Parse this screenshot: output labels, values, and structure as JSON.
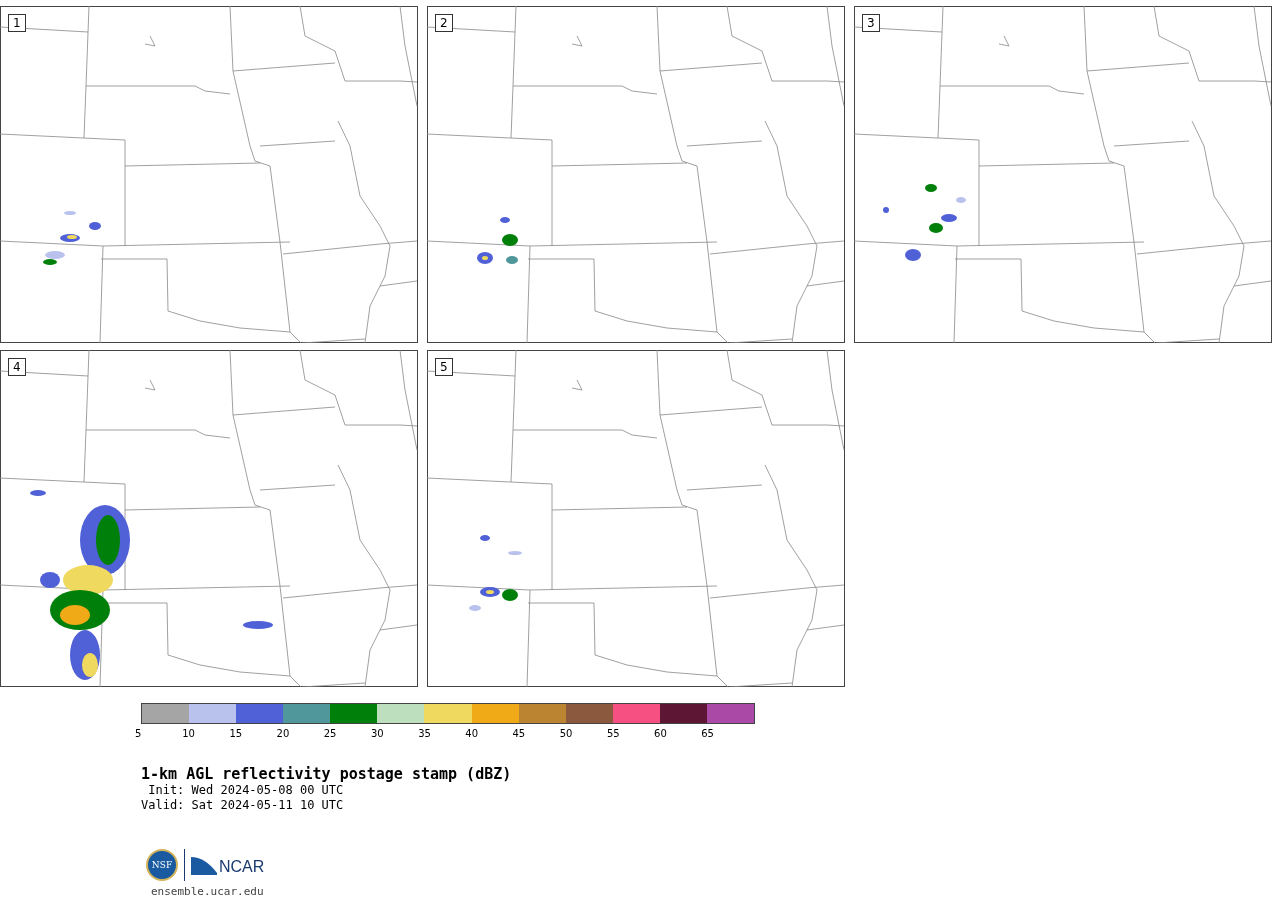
{
  "panels": [
    {
      "label": "1"
    },
    {
      "label": "2"
    },
    {
      "label": "3"
    },
    {
      "label": "4"
    },
    {
      "label": "5"
    }
  ],
  "colorbar": {
    "segments": [
      {
        "color": "#a5a5a5"
      },
      {
        "color": "#b8c2ed"
      },
      {
        "color": "#5060d6"
      },
      {
        "color": "#4f979b"
      },
      {
        "color": "#00800a"
      },
      {
        "color": "#bddfbe"
      },
      {
        "color": "#efd95e"
      },
      {
        "color": "#f0aa18"
      },
      {
        "color": "#bb8430"
      },
      {
        "color": "#8b5a3e"
      },
      {
        "color": "#f65082"
      },
      {
        "color": "#5e1635"
      },
      {
        "color": "#ab4aa6"
      }
    ],
    "ticks": [
      "5",
      "10",
      "15",
      "20",
      "25",
      "30",
      "35",
      "40",
      "45",
      "50",
      "55",
      "60",
      "65"
    ]
  },
  "title": "1-km AGL reflectivity postage stamp (dBZ)",
  "init": " Init: Wed 2024-05-08 00 UTC",
  "valid": "Valid: Sat 2024-05-11 10 UTC",
  "logo": {
    "nsf": "NSF",
    "ncar": "NCAR"
  },
  "url": "ensemble.ucar.edu"
}
